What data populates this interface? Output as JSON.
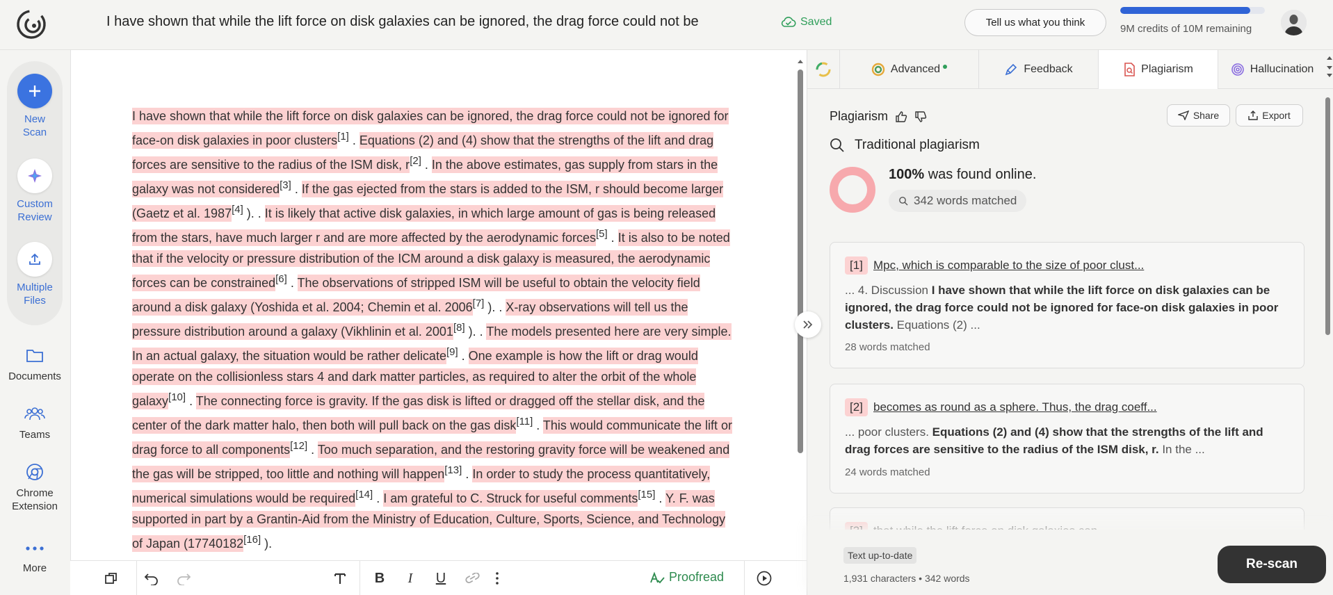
{
  "header": {
    "doc_title": "I have shown that while the lift force on disk galaxies can be ignored, the drag force could not be",
    "saved_label": "Saved",
    "feedback_label": "Tell us what you think",
    "credits_text": "9M credits of 10M remaining",
    "credits_fraction": 0.9
  },
  "sidebar": {
    "new_scan": "New Scan",
    "custom_review": "Custom Review",
    "multiple_files": "Multiple Files",
    "documents": "Documents",
    "teams": "Teams",
    "chrome_extension": "Chrome Extension",
    "more": "More"
  },
  "editor": {
    "segments": [
      {
        "text": "I have shown that while the lift force on disk galaxies can be ignored, the drag force could not be ignored for face-on disk galaxies in poor clusters",
        "ref": "[1]"
      },
      {
        "text": "Equations (2) and (4) show that the strengths of the lift and drag forces are sensitive to the radius of the ISM disk, r",
        "ref": "[2]"
      },
      {
        "text": "In the above estimates, gas supply from stars in the galaxy was not considered",
        "ref": "[3]"
      },
      {
        "text": "If the gas ejected from the stars is added to the ISM, r should become larger (Gaetz et al. 1987",
        "ref": "[4]",
        "tail": " )."
      },
      {
        "text": "It is likely that active disk galaxies, in which large amount of gas is being released from the stars, have much larger r and are more affected by the aerodynamic forces",
        "ref": "[5]"
      },
      {
        "text": "It is also to be noted that if the velocity or pressure distribution of the ICM around a disk galaxy is measured, the aerodynamic forces can be constrained",
        "ref": "[6]"
      },
      {
        "text": "The observations of stripped ISM will be useful to obtain the velocity field around a disk galaxy (Yoshida et al. 2004; Chemin et al. 2006",
        "ref": "[7]",
        "tail": " )."
      },
      {
        "text": "X-ray observations will tell us the pressure distribution around a galaxy (Vikhlinin et al. 2001",
        "ref": "[8]",
        "tail": " )."
      },
      {
        "text": "The models presented here are very simple. In an actual galaxy, the situation would be rather delicate",
        "ref": "[9]"
      },
      {
        "text": "One example is how the lift or drag would operate on the collisionless stars 4 and dark matter particles, as required to alter the orbit of the whole galaxy",
        "ref": "[10]"
      },
      {
        "text": "The connecting force is gravity. If the gas disk is lifted or dragged off the stellar disk, and the center of the dark matter halo, then both will pull back on the gas disk",
        "ref": "[11]"
      },
      {
        "text": "This would communicate the lift or drag force to all components",
        "ref": "[12]"
      },
      {
        "text": "Too much separation, and the restoring gravity force will be weakened and the gas will be stripped, too little and nothing will happen",
        "ref": "[13]"
      },
      {
        "text": "In order to study the process quantitatively, numerical simulations would be required",
        "ref": "[14]"
      },
      {
        "text": "I am grateful to C. Struck for useful comments",
        "ref": "[15]"
      },
      {
        "text": "Y. F. was supported in part by a Grantin-Aid from the Ministry of Education, Culture, Sports, Science, and Technology of Japan (17740182",
        "ref": "[16]",
        "tail": " )."
      }
    ]
  },
  "toolbar": {
    "proofread_label": "Proofread"
  },
  "panel": {
    "tabs": [
      {
        "label": "Advanced"
      },
      {
        "label": "Feedback"
      },
      {
        "label": "Plagiarism"
      },
      {
        "label": "Hallucination"
      }
    ],
    "title": "Plagiarism",
    "share_label": "Share",
    "export_label": "Export",
    "search_label": "Traditional plagiarism",
    "percent": "100%",
    "percent_suffix": " was found online.",
    "words_matched": "342 words matched",
    "results": [
      {
        "num": "[1]",
        "link": "Mpc, which is comparable to the size of poor clust...",
        "pre": "... 4. Discussion ",
        "bold": "I have shown that while the lift force on disk galaxies can be ignored, the drag force could not be ignored for face-on disk galaxies in poor clusters.",
        "post": " Equations (2) ...",
        "matched": "28 words matched"
      },
      {
        "num": "[2]",
        "link": "becomes as round as a sphere. Thus, the drag coeff...",
        "pre": "... poor clusters. ",
        "bold": "Equations (2) and (4) show that the strengths of the lift and drag forces are sensitive to the radius of the ISM disk, r.",
        "post": " In the ...",
        "matched": "24 words matched"
      },
      {
        "num": "[3]",
        "link": "that while the lift force on disk galaxies can..."
      }
    ],
    "status_chip": "Text up-to-date",
    "counts": "1,931 characters • 342 words",
    "rescan_label": "Re-scan"
  }
}
